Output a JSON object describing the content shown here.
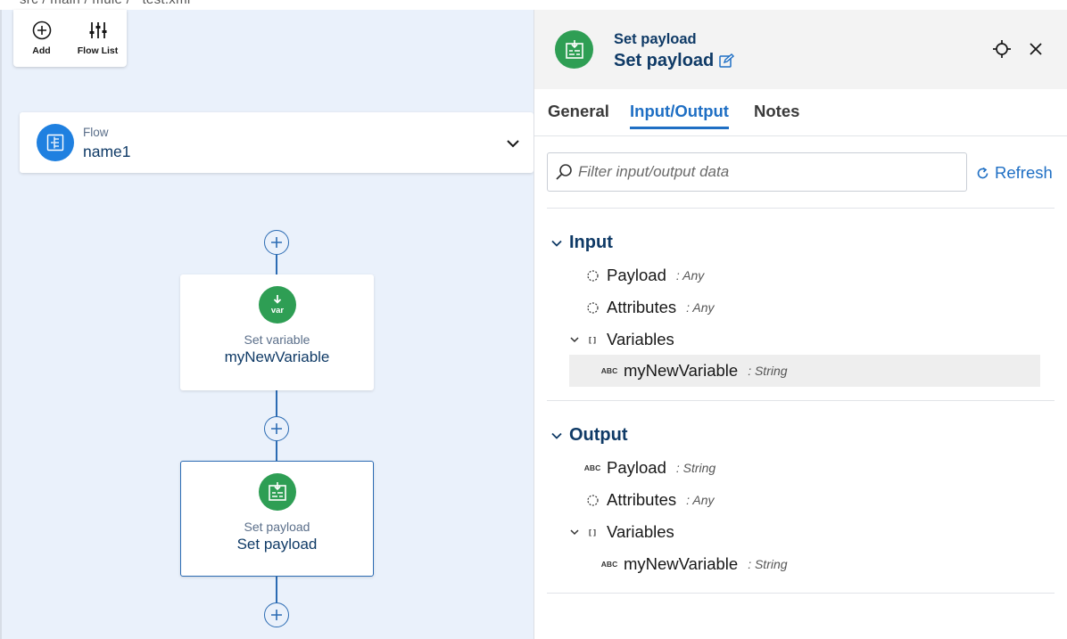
{
  "breadcrumb": "src / main / mule /   test.xml",
  "toolbar": {
    "add_label": "Add",
    "flow_list_label": "Flow List"
  },
  "flow_card": {
    "type_label": "Flow",
    "name": "name1"
  },
  "nodes": [
    {
      "type_label": "Set variable",
      "name": "myNewVariable",
      "icon": "var-icon"
    },
    {
      "type_label": "Set payload",
      "name": "Set payload",
      "icon": "set-payload-icon"
    }
  ],
  "panel": {
    "subtitle": "Set payload",
    "title": "Set payload",
    "tabs": [
      {
        "label": "General"
      },
      {
        "label": "Input/Output"
      },
      {
        "label": "Notes"
      }
    ],
    "active_tab": "Input/Output",
    "filter_placeholder": "Filter input/output data",
    "refresh_label": "Refresh",
    "input": {
      "title": "Input",
      "rows": [
        {
          "name": "Payload",
          "type": ": Any",
          "icon": "any-icon"
        },
        {
          "name": "Attributes",
          "type": ": Any",
          "icon": "any-icon"
        },
        {
          "name": "Variables",
          "type": "",
          "icon": "object-icon",
          "expanded": true
        },
        {
          "name": "myNewVariable",
          "type": ": String",
          "icon": "string-icon",
          "selected": true
        }
      ]
    },
    "output": {
      "title": "Output",
      "rows": [
        {
          "name": "Payload",
          "type": ": String",
          "icon": "string-icon"
        },
        {
          "name": "Attributes",
          "type": ": Any",
          "icon": "any-icon"
        },
        {
          "name": "Variables",
          "type": "",
          "icon": "object-icon",
          "expanded": true
        },
        {
          "name": "myNewVariable",
          "type": ": String",
          "icon": "string-icon"
        }
      ]
    },
    "string_glyph": "ABC",
    "object_glyph": "[ ]"
  },
  "colors": {
    "accent": "#1f6fc4",
    "node_green": "#2e9e54",
    "canvas_bg": "#eaf1fb",
    "navy_text": "#0f3a66"
  }
}
